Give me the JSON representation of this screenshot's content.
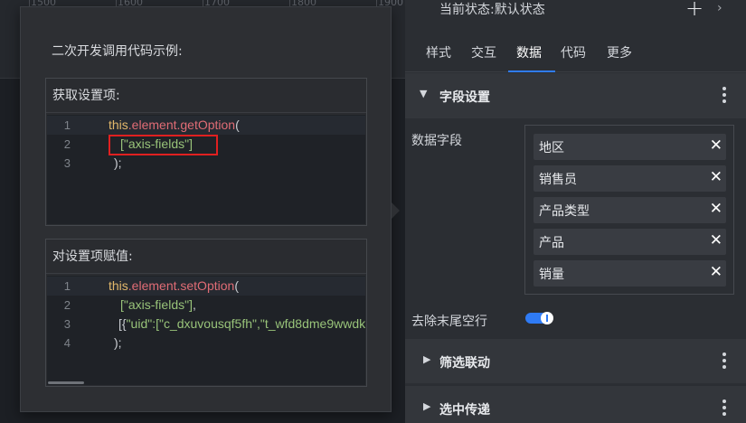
{
  "ruler": {
    "ticks": [
      "1500",
      "1600",
      "1700",
      "1800",
      "1900"
    ]
  },
  "popup": {
    "title": "二次开发调用代码示例:",
    "get_box": {
      "title": "获取设置项:",
      "lines": [
        {
          "no": "1",
          "this": "this",
          "method": ".element.getOption",
          "rest": "("
        },
        {
          "no": "2",
          "str": "[\"axis-fields\"]"
        },
        {
          "no": "3",
          "punc": ");"
        }
      ]
    },
    "set_box": {
      "title": "对设置项赋值:",
      "lines": [
        {
          "no": "1",
          "this": "this",
          "method": ".element.setOption",
          "rest": "("
        },
        {
          "no": "2",
          "str": "[\"axis-fields\"]",
          "punc": ","
        },
        {
          "no": "3",
          "punc_pre": "[{",
          "str": "\"uid\":[\"c_dxuvousqf5fh\",\"t_wfd8dme9wwdk"
        },
        {
          "no": "4",
          "punc": ");"
        }
      ]
    }
  },
  "panel": {
    "state_label": "当前状态:默认状态",
    "add_icon": "plus-icon",
    "tabs": [
      "样式",
      "交互",
      "数据",
      "代码",
      "更多"
    ],
    "active_tab": "数据",
    "sections": {
      "field_settings": "字段设置",
      "filter_link": "筛选联动",
      "select_pass": "选中传递"
    },
    "data_fields_label": "数据字段",
    "data_fields": [
      "地区",
      "销售员",
      "产品类型",
      "产品",
      "销量"
    ],
    "trim_label": "去除末尾空行",
    "trim_enabled": true
  },
  "colors": {
    "accent": "#2f7bf5",
    "highlight": "#e02020"
  }
}
